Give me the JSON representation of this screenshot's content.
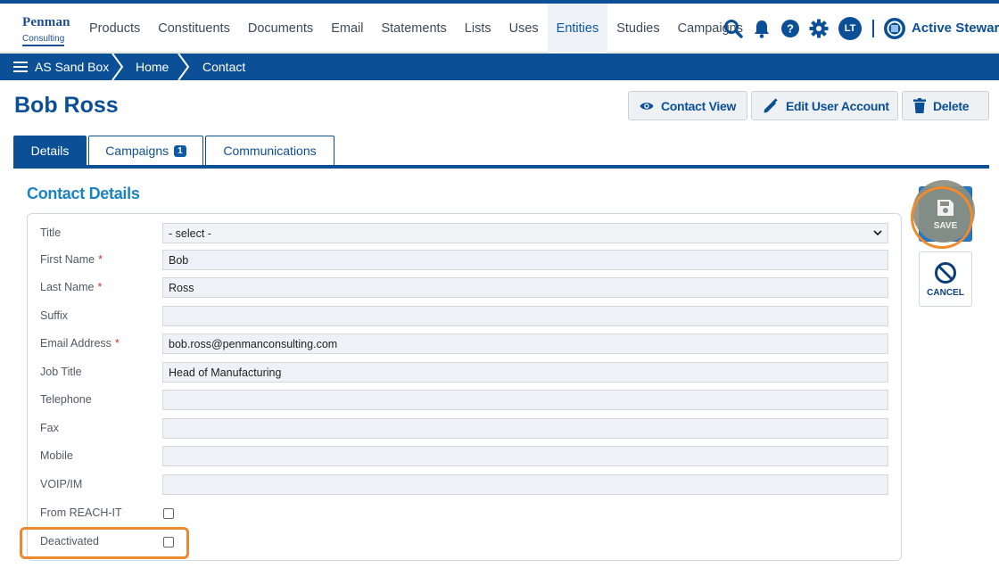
{
  "logo": {
    "line1": "Penman",
    "line2": "Consulting"
  },
  "nav": [
    "Products",
    "Constituents",
    "Documents",
    "Email",
    "Statements",
    "Lists",
    "Uses",
    "Entities",
    "Studies",
    "Campaigns"
  ],
  "nav_active": "Entities",
  "user_initials": "LT",
  "brand": "Active Steward",
  "breadcrumb": {
    "menu": "AS Sand Box",
    "home": "Home",
    "current": "Contact"
  },
  "page_title": "Bob Ross",
  "actions": {
    "contact_view": "Contact View",
    "edit_account": "Edit User Account",
    "delete": "Delete"
  },
  "tabs": {
    "details": "Details",
    "campaigns": "Campaigns",
    "campaigns_count": "1",
    "communications": "Communications"
  },
  "section_title": "Contact Details",
  "form": {
    "title_label": "Title",
    "title_value": "- select -",
    "first_name_label": "First Name",
    "first_name_value": "Bob",
    "last_name_label": "Last Name",
    "last_name_value": "Ross",
    "suffix_label": "Suffix",
    "suffix_value": "",
    "email_label": "Email Address",
    "email_value": "bob.ross@penmanconsulting.com",
    "job_title_label": "Job Title",
    "job_title_value": "Head of Manufacturing",
    "telephone_label": "Telephone",
    "telephone_value": "",
    "fax_label": "Fax",
    "fax_value": "",
    "mobile_label": "Mobile",
    "mobile_value": "",
    "voip_label": "VOIP/IM",
    "voip_value": "",
    "from_reachit_label": "From REACH-IT",
    "deactivated_label": "Deactivated"
  },
  "required_mark": "*",
  "side": {
    "save": "SAVE",
    "cancel": "CANCEL"
  },
  "colors": {
    "primary": "#0b4f96",
    "accent": "#1b83c4",
    "highlight": "#ea8a33"
  }
}
